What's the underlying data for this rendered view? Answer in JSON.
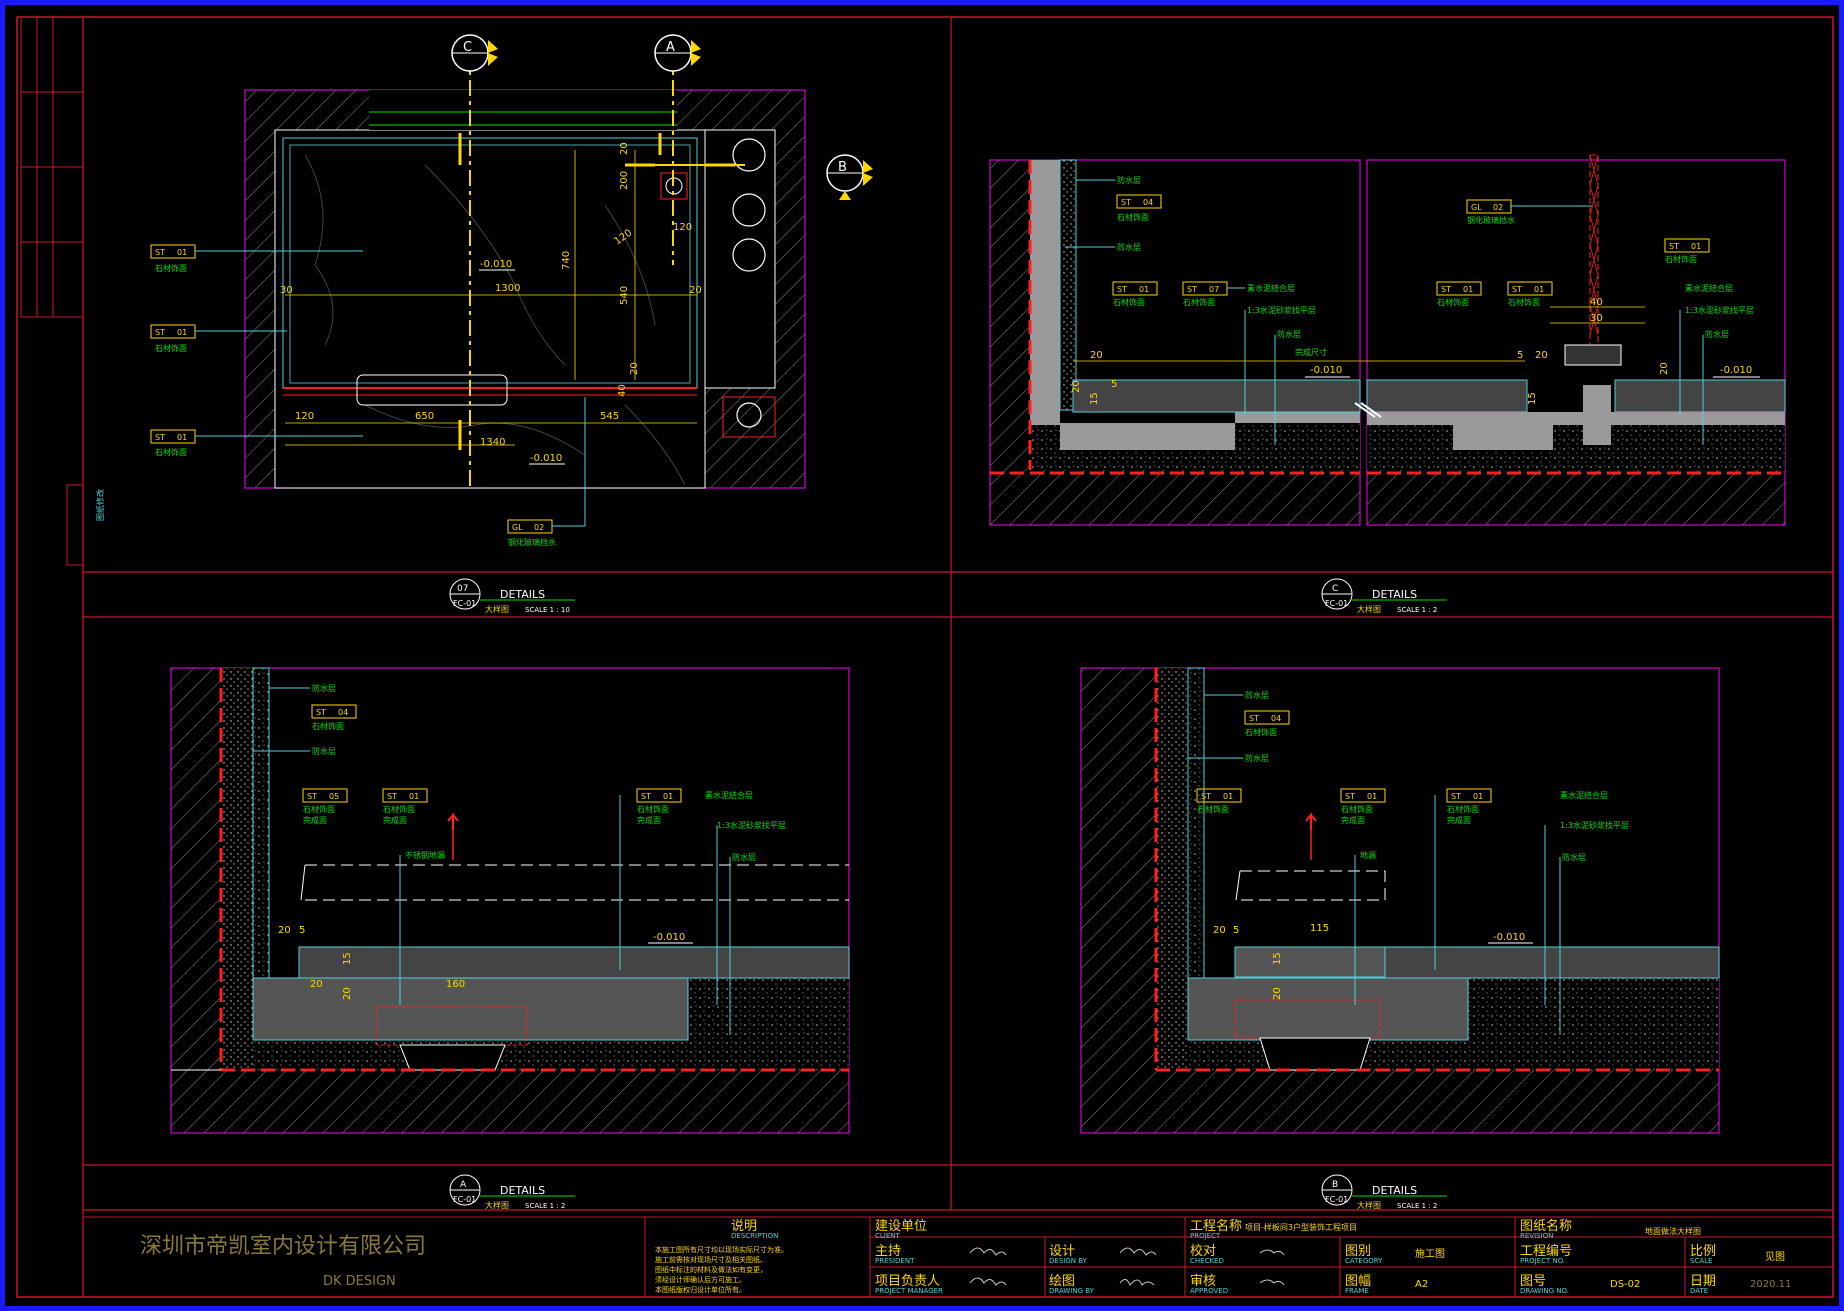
{
  "panels": [
    {
      "id": "07",
      "ref": "FC-01",
      "title": "DETAILS",
      "sub": "大样图",
      "scale": "SCALE  1 : 10"
    },
    {
      "id": "C",
      "ref": "FC-01",
      "title": "DETAILS",
      "sub": "大样图",
      "scale": "SCALE  1 : 2"
    },
    {
      "id": "A",
      "ref": "FC-01",
      "title": "DETAILS",
      "sub": "大样图",
      "scale": "SCALE  1 : 2"
    },
    {
      "id": "B",
      "ref": "FC-01",
      "title": "DETAILS",
      "sub": "大样图",
      "scale": "SCALE  1 : 2"
    }
  ],
  "section_marks": {
    "c": "C",
    "a": "A",
    "b": "B"
  },
  "plan": {
    "level_1": "-0.010",
    "level_2": "-0.010",
    "dims": {
      "d1300": "1300",
      "d1340": "1340",
      "d650": "650",
      "d545": "545",
      "d120a": "120",
      "d120b": "120",
      "d740": "740",
      "d540": "540",
      "d200": "200",
      "d20a": "20",
      "d20b": "20",
      "d30": "30",
      "d40": "40",
      "d120c": "120",
      "d20c": "20"
    },
    "tags": [
      {
        "code": "ST",
        "num": "01",
        "note": "石材饰面"
      },
      {
        "code": "ST",
        "num": "01",
        "note": "石材饰面"
      },
      {
        "code": "ST",
        "num": "01",
        "note": "石材饰面"
      },
      {
        "code": "GL",
        "num": "02",
        "note": "钢化玻璃挡水"
      }
    ]
  },
  "section_c": {
    "level_1": "-0.010",
    "level_2": "-0.010",
    "notes": [
      "防水层",
      "石材饰面",
      "防水层",
      "1:3水泥砂浆找平层",
      "防水层",
      "钢化玻璃挡水",
      "1:3水泥砂浆找平层",
      "防水层",
      "防水层"
    ],
    "dims": {
      "d20a": "20",
      "d20b": "20",
      "d20c": "20",
      "d5a": "5",
      "d5b": "5",
      "d15a": "15",
      "d15b": "15",
      "d40": "40",
      "d30": "30",
      "d20d": "20"
    },
    "label_mid": "完成尺寸"
  },
  "section_a": {
    "level": "-0.010",
    "notes": [
      "防水层",
      "石材饰面",
      "防水层",
      "不锈钢地漏",
      "石材饰面",
      "1:3水泥砂浆找平层",
      "防水层"
    ],
    "dims": {
      "d20a": "20",
      "d5": "5",
      "d15": "15",
      "d20b": "20",
      "d160": "160",
      "d20c": "20"
    }
  },
  "section_b": {
    "level": "-0.010",
    "notes": [
      "防水层",
      "石材饰面",
      "防水层",
      "地漏",
      "石材饰面",
      "1:3水泥砂浆找平层",
      "防水层"
    ],
    "dims": {
      "d20a": "20",
      "d5": "5",
      "d15": "15",
      "d115": "115",
      "d20b": "20"
    }
  },
  "title_block": {
    "company": "深圳市帝凯室内设计有限公司",
    "company_en": "DK   DESIGN",
    "desc_label": "说明",
    "desc_sub": "DESCRIPTION",
    "client_label": "建设单位",
    "client_sub": "CLIENT",
    "project_label": "工程名称",
    "project_sub": "PROJECT",
    "project_name": "项目-样板间3户型装饰工程项目",
    "drawing_label": "图纸名称",
    "drawing_sub": "REVISION",
    "drawing_name": "地面做法大样图",
    "principal": "主持",
    "principal_sub": "PRESIDENT",
    "design": "设计",
    "design_sub": "DESIGN BY",
    "check": "校对",
    "check_sub": "CHECKED",
    "category": "图别",
    "category_sub": "CATEGORY",
    "category_val": "施工图",
    "project_no": "工程编号",
    "project_no_sub": "PROJECT NO.",
    "manager": "项目负责人",
    "manager_sub": "PROJECT MANAGER",
    "drawn": "绘图",
    "drawn_sub": "DRAWING BY",
    "approved": "审核",
    "approved_sub": "APPROVED",
    "frame": "图幅",
    "frame_sub": "FRAME",
    "frame_val": "A2",
    "drawing_no": "图号",
    "drawing_no_sub": "DRAWING NO.",
    "drawing_no_val": "DS-02",
    "scale": "比例",
    "scale_sub": "SCALE",
    "scale_val": "见图",
    "date": "日期",
    "date_sub": "DATE",
    "date_val": "2020.11"
  },
  "side_strip": {
    "stamp": "图纸修改"
  },
  "colors": {
    "border": "#1a1aff",
    "frame": "#d0142c",
    "cyan": "#4fd1d9",
    "yellow": "#ffd700",
    "green": "#00e000",
    "magenta": "#d000d0",
    "red": "#ff2020"
  }
}
